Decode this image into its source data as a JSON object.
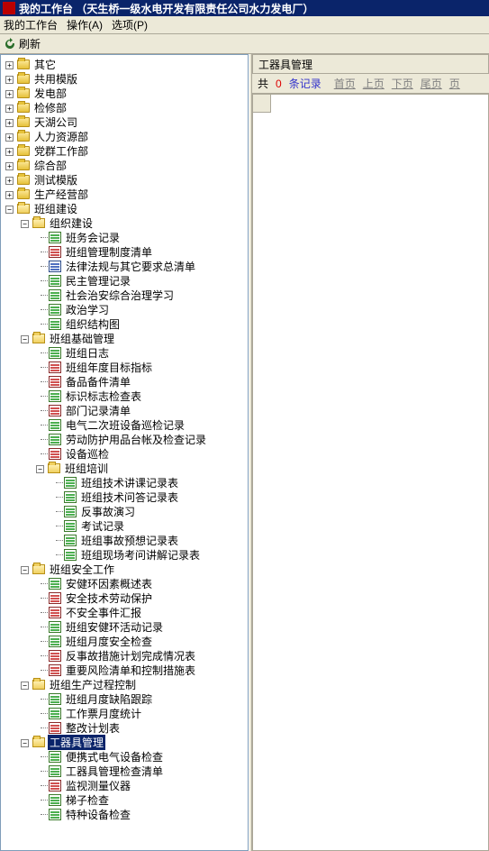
{
  "window": {
    "title": "我的工作台 （天生桥一级水电开发有限责任公司水力发电厂）"
  },
  "menubar": {
    "workbench": "我的工作台",
    "operate": "操作(A)",
    "options": "选项(P)"
  },
  "toolbar": {
    "refresh": "刷新"
  },
  "right": {
    "panel_title": "工器具管理",
    "pager_prefix": "共",
    "pager_count": "0",
    "pager_suffix": "条记录",
    "nav_first": "首页",
    "nav_prev": "上页",
    "nav_next": "下页",
    "nav_last": "尾页",
    "nav_page": "页"
  },
  "tree": {
    "roots": [
      {
        "label": "其它",
        "toggle": "+",
        "icon": "folder-closed"
      },
      {
        "label": "共用模版",
        "toggle": "+",
        "icon": "folder-closed"
      },
      {
        "label": "发电部",
        "toggle": "+",
        "icon": "folder-closed"
      },
      {
        "label": "检修部",
        "toggle": "+",
        "icon": "folder-closed"
      },
      {
        "label": "天湖公司",
        "toggle": "+",
        "icon": "folder-closed"
      },
      {
        "label": "人力资源部",
        "toggle": "+",
        "icon": "folder-closed"
      },
      {
        "label": "党群工作部",
        "toggle": "+",
        "icon": "folder-closed"
      },
      {
        "label": "综合部",
        "toggle": "+",
        "icon": "folder-closed"
      },
      {
        "label": "测试模版",
        "toggle": "+",
        "icon": "folder-closed"
      },
      {
        "label": "生产经营部",
        "toggle": "+",
        "icon": "folder-closed"
      }
    ],
    "bzjs": {
      "label": "班组建设",
      "toggle": "-",
      "icon": "folder-open",
      "zzjs": {
        "label": "组织建设",
        "toggle": "-",
        "icon": "folder-open",
        "items": [
          {
            "label": "班务会记录",
            "icon": "doc-green"
          },
          {
            "label": "班组管理制度清单",
            "icon": "doc-red"
          },
          {
            "label": "法律法规与其它要求总清单",
            "icon": "doc-blue"
          },
          {
            "label": "民主管理记录",
            "icon": "doc-green"
          },
          {
            "label": "社会治安综合治理学习",
            "icon": "doc-green"
          },
          {
            "label": "政治学习",
            "icon": "doc-green"
          },
          {
            "label": "组织结构图",
            "icon": "doc-green"
          }
        ]
      },
      "bzjcgl": {
        "label": "班组基础管理",
        "toggle": "-",
        "icon": "folder-open",
        "items": [
          {
            "label": "班组日志",
            "icon": "doc-green"
          },
          {
            "label": "班组年度目标指标",
            "icon": "doc-red"
          },
          {
            "label": "备品备件清单",
            "icon": "doc-red"
          },
          {
            "label": "标识标志检查表",
            "icon": "doc-green"
          },
          {
            "label": "部门记录清单",
            "icon": "doc-red"
          },
          {
            "label": "电气二次班设备巡检记录",
            "icon": "doc-green"
          },
          {
            "label": "劳动防护用品台帐及检查记录",
            "icon": "doc-green"
          },
          {
            "label": "设备巡检",
            "icon": "doc-red"
          }
        ],
        "bzpx": {
          "label": "班组培训",
          "toggle": "-",
          "icon": "folder-open",
          "items": [
            {
              "label": "班组技术讲课记录表",
              "icon": "doc-green"
            },
            {
              "label": "班组技术问答记录表",
              "icon": "doc-green"
            },
            {
              "label": "反事故演习",
              "icon": "doc-green"
            },
            {
              "label": "考试记录",
              "icon": "doc-green"
            },
            {
              "label": "班组事故预想记录表",
              "icon": "doc-green"
            },
            {
              "label": "班组现场考问讲解记录表",
              "icon": "doc-green"
            }
          ]
        }
      },
      "bzaqgz": {
        "label": "班组安全工作",
        "toggle": "-",
        "icon": "folder-open",
        "items": [
          {
            "label": "安健环因素概述表",
            "icon": "doc-green"
          },
          {
            "label": "安全技术劳动保护",
            "icon": "doc-red"
          },
          {
            "label": "不安全事件汇报",
            "icon": "doc-red"
          },
          {
            "label": "班组安健环活动记录",
            "icon": "doc-green"
          },
          {
            "label": "班组月度安全检查",
            "icon": "doc-green"
          },
          {
            "label": "反事故措施计划完成情况表",
            "icon": "doc-red"
          },
          {
            "label": "重要风险清单和控制措施表",
            "icon": "doc-red"
          }
        ]
      },
      "bzscgckz": {
        "label": "班组生产过程控制",
        "toggle": "-",
        "icon": "folder-open",
        "items": [
          {
            "label": "班组月度缺陷跟踪",
            "icon": "doc-green"
          },
          {
            "label": "工作票月度统计",
            "icon": "doc-green"
          },
          {
            "label": "整改计划表",
            "icon": "doc-red"
          }
        ]
      },
      "gqjgl": {
        "label": "工器具管理",
        "toggle": "-",
        "icon": "folder-open",
        "selected": true,
        "items": [
          {
            "label": "便携式电气设备检查",
            "icon": "doc-green"
          },
          {
            "label": "工器具管理检查清单",
            "icon": "doc-green"
          },
          {
            "label": "监视测量仪器",
            "icon": "doc-red"
          },
          {
            "label": "梯子检查",
            "icon": "doc-green"
          },
          {
            "label": "特种设备检查",
            "icon": "doc-green"
          }
        ]
      }
    }
  }
}
